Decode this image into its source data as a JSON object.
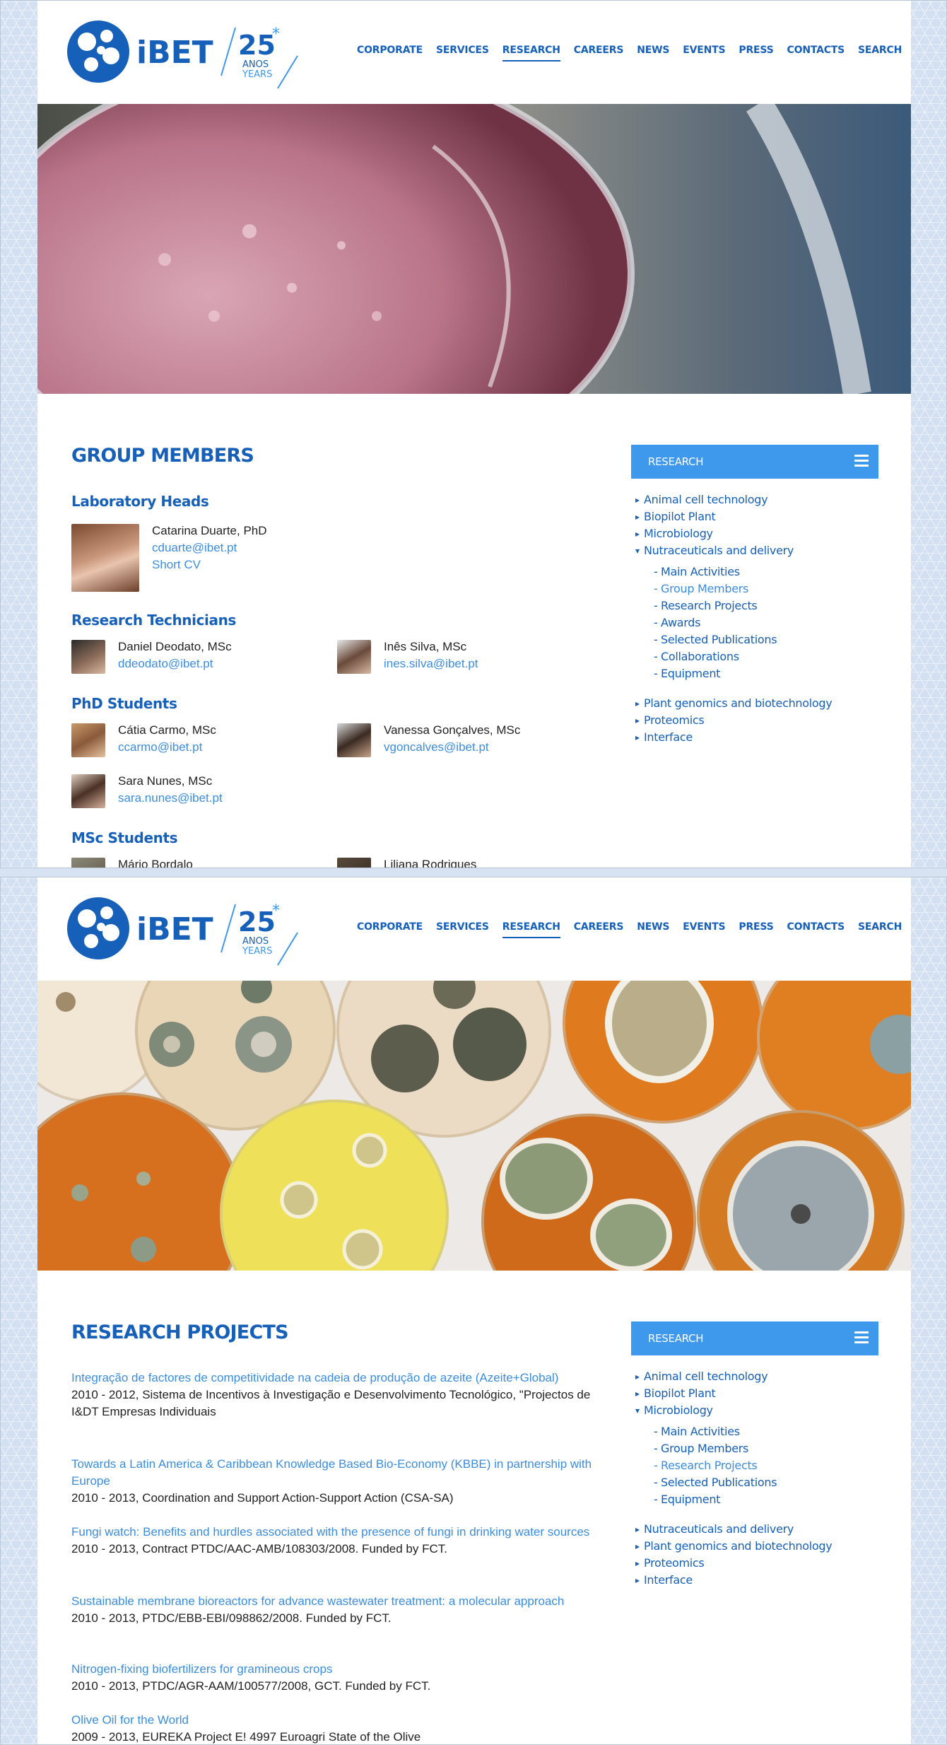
{
  "brand": {
    "name": "iBET",
    "anniv_number": "25",
    "anniv_line1": "ANOS",
    "anniv_line2": "YEARS"
  },
  "nav": [
    "CORPORATE",
    "SERVICES",
    "RESEARCH",
    "CAREERS",
    "NEWS",
    "EVENTS",
    "PRESS",
    "CONTACTS",
    "SEARCH"
  ],
  "colors": {
    "primary": "#1660b9",
    "accent": "#3e98ec",
    "link": "#3b8de0"
  },
  "screen1": {
    "title": "GROUP MEMBERS",
    "lab_heads": {
      "heading": "Laboratory Heads",
      "name": "Catarina Duarte, PhD",
      "email": "cduarte@ibet.pt",
      "cv": "Short CV"
    },
    "technicians": {
      "heading": "Research Technicians",
      "people": [
        {
          "name": "Daniel Deodato, MSc",
          "email": "ddeodato@ibet.pt"
        },
        {
          "name": "Inês Silva, MSc",
          "email": "ines.silva@ibet.pt"
        }
      ]
    },
    "phd": {
      "heading": "PhD Students",
      "people": [
        {
          "name": "Cátia Carmo, MSc",
          "email": "ccarmo@ibet.pt"
        },
        {
          "name": "Vanessa Gonçalves, MSc",
          "email": "vgoncalves@ibet.pt"
        },
        {
          "name": "Sara Nunes, MSc",
          "email": "sara.nunes@ibet.pt"
        }
      ]
    },
    "msc": {
      "heading": "MSc Students",
      "people": [
        {
          "name": "Mário Bordalo"
        },
        {
          "name": "Liliana Rodrigues"
        }
      ]
    },
    "sidebar": {
      "title": "RESEARCH",
      "top": [
        "Animal cell technology",
        "Biopilot Plant",
        "Microbiology"
      ],
      "open": "Nutraceuticals and delivery",
      "subs": [
        "Main Activities",
        "Group Members",
        "Research Projects",
        "Awards",
        "Selected Publications",
        "Collaborations",
        "Equipment"
      ],
      "current": "Group Members",
      "bottom": [
        "Plant genomics and biotechnology",
        "Proteomics",
        "Interface"
      ]
    }
  },
  "screen2": {
    "title": "RESEARCH PROJECTS",
    "projects": [
      {
        "title": "Integração de factores de competitividade na cadeia de produção de azeite (Azeite+Global)",
        "detail": "2010 - 2012, Sistema de Incentivos à Investigação e Desenvolvimento Tecnológico, \"Projectos de I&DT Empresas Individuais"
      },
      {
        "title": "Towards a Latin America & Caribbean Knowledge Based Bio-Economy (KBBE) in partnership with Europe",
        "detail": "2010 - 2013, Coordination and Support Action-Support Action (CSA-SA)"
      },
      {
        "title": "Fungi watch: Benefits and hurdles associated with the presence of fungi in drinking water sources",
        "detail": "2010 - 2013, Contract PTDC/AAC-AMB/108303/2008. Funded by FCT."
      },
      {
        "title": "Sustainable membrane bioreactors for advance wastewater treatment: a molecular approach",
        "detail": "2010 - 2013, PTDC/EBB-EBI/098862/2008. Funded by FCT."
      },
      {
        "title": "Nitrogen-fixing biofertilizers for gramineous crops",
        "detail": "2010 - 2013, PTDC/AGR-AAM/100577/2008, GCT. Funded by FCT."
      },
      {
        "title": "Olive Oil for the World",
        "detail": "2009 - 2013, EUREKA Project E! 4997 Euroagri State of the Olive"
      }
    ],
    "sidebar": {
      "title": "RESEARCH",
      "top": [
        "Animal cell technology",
        "Biopilot Plant"
      ],
      "open": "Microbiology",
      "subs": [
        "Main Activities",
        "Group Members",
        "Research Projects",
        "Selected Publications",
        "Equipment"
      ],
      "current": "Research Projects",
      "bottom": [
        "Nutraceuticals and delivery",
        "Plant genomics and biotechnology",
        "Proteomics",
        "Interface"
      ]
    }
  }
}
